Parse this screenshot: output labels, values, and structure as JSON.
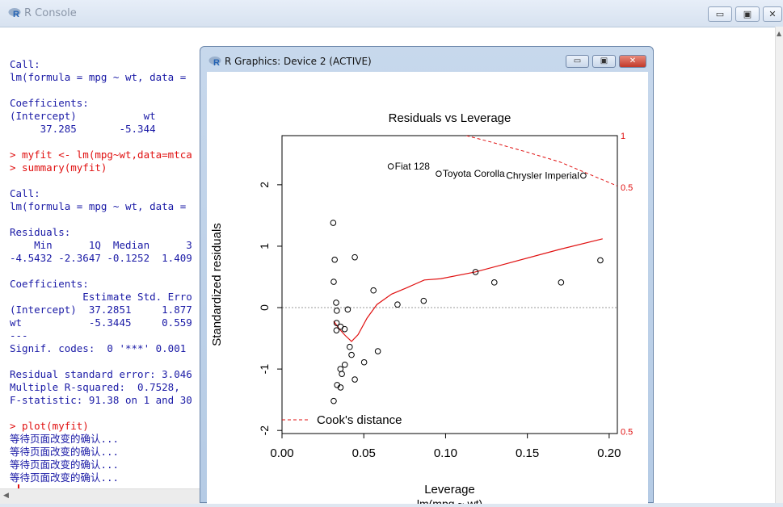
{
  "console": {
    "title": "R Console",
    "lines": [
      {
        "t": "",
        "c": ""
      },
      {
        "t": "Call:",
        "c": ""
      },
      {
        "t": "lm(formula = mpg ~ wt, data = ",
        "c": ""
      },
      {
        "t": "",
        "c": ""
      },
      {
        "t": "Coefficients:",
        "c": ""
      },
      {
        "t": "(Intercept)           wt",
        "c": ""
      },
      {
        "t": "     37.285       -5.344",
        "c": ""
      },
      {
        "t": "",
        "c": ""
      },
      {
        "t": "> myfit <- lm(mpg~wt,data=mtca",
        "c": "red"
      },
      {
        "t": "> summary(myfit)",
        "c": "red"
      },
      {
        "t": "",
        "c": ""
      },
      {
        "t": "Call:",
        "c": ""
      },
      {
        "t": "lm(formula = mpg ~ wt, data = ",
        "c": ""
      },
      {
        "t": "",
        "c": ""
      },
      {
        "t": "Residuals:",
        "c": ""
      },
      {
        "t": "    Min      1Q  Median      3",
        "c": ""
      },
      {
        "t": "-4.5432 -2.3647 -0.1252  1.409",
        "c": ""
      },
      {
        "t": "",
        "c": ""
      },
      {
        "t": "Coefficients:",
        "c": ""
      },
      {
        "t": "            Estimate Std. Erro",
        "c": ""
      },
      {
        "t": "(Intercept)  37.2851     1.877",
        "c": ""
      },
      {
        "t": "wt           -5.3445     0.559",
        "c": ""
      },
      {
        "t": "---",
        "c": ""
      },
      {
        "t": "Signif. codes:  0 '***' 0.001",
        "c": ""
      },
      {
        "t": "",
        "c": ""
      },
      {
        "t": "Residual standard error: 3.046",
        "c": ""
      },
      {
        "t": "Multiple R-squared:  0.7528,",
        "c": ""
      },
      {
        "t": "F-statistic: 91.38 on 1 and 30",
        "c": ""
      },
      {
        "t": "",
        "c": ""
      },
      {
        "t": "> plot(myfit)",
        "c": "red"
      },
      {
        "t": "等待页面改变的确认...",
        "c": ""
      },
      {
        "t": "等待页面改变的确认...",
        "c": ""
      },
      {
        "t": "等待页面改变的确认...",
        "c": ""
      },
      {
        "t": "等待页面改变的确认...",
        "c": ""
      }
    ],
    "prompt": ">",
    "window_buttons": {
      "minimize": "▭",
      "maximize": "▣",
      "close": "✕"
    }
  },
  "graphics": {
    "title": "R Graphics: Device 2 (ACTIVE)",
    "window_buttons": {
      "minimize": "▭",
      "maximize": "▣",
      "close": "✕"
    }
  },
  "chart_data": {
    "type": "scatter",
    "title": "Residuals vs Leverage",
    "xlabel": "Leverage",
    "subtitle": "lm(mpg ~ wt)",
    "ylabel": "Standardized residuals",
    "xlim": [
      0.0,
      0.205
    ],
    "ylim": [
      -2.05,
      2.8
    ],
    "xticks": [
      0.0,
      0.05,
      0.1,
      0.15,
      0.2
    ],
    "xtick_labels": [
      "0.00",
      "0.05",
      "0.10",
      "0.15",
      "0.20"
    ],
    "yticks": [
      -2,
      -1,
      0,
      1,
      2
    ],
    "ytick_labels": [
      "-2",
      "-1",
      "0",
      "1",
      "2"
    ],
    "right_labels": [
      {
        "y": 2.8,
        "text": "1"
      },
      {
        "y": 1.96,
        "text": "0.5"
      },
      {
        "y": -2.02,
        "text": "0.5"
      }
    ],
    "points": [
      [
        0.0313,
        1.38
      ],
      [
        0.0322,
        0.78
      ],
      [
        0.0316,
        0.42
      ],
      [
        0.0331,
        0.08
      ],
      [
        0.0335,
        -0.05
      ],
      [
        0.0334,
        -0.25
      ],
      [
        0.0333,
        -0.37
      ],
      [
        0.0358,
        -0.31
      ],
      [
        0.0383,
        -0.35
      ],
      [
        0.0402,
        -0.03
      ],
      [
        0.0414,
        -0.64
      ],
      [
        0.0425,
        -0.77
      ],
      [
        0.0384,
        -0.93
      ],
      [
        0.0357,
        -1.0
      ],
      [
        0.0366,
        -1.08
      ],
      [
        0.0337,
        -1.26
      ],
      [
        0.0358,
        -1.3
      ],
      [
        0.0445,
        -1.17
      ],
      [
        0.0316,
        -1.52
      ],
      [
        0.0445,
        0.82
      ],
      [
        0.0502,
        -0.89
      ],
      [
        0.0559,
        0.28
      ],
      [
        0.0586,
        -0.71
      ],
      [
        0.0706,
        0.05
      ],
      [
        0.0866,
        0.11
      ],
      [
        0.1183,
        0.58
      ],
      [
        0.1298,
        0.41
      ],
      [
        0.1706,
        0.41
      ],
      [
        0.1946,
        0.77
      ],
      [
        0.0665,
        2.3
      ],
      [
        0.0958,
        2.18
      ],
      [
        0.1842,
        2.15
      ]
    ],
    "point_labels": [
      {
        "x": 0.0665,
        "y": 2.3,
        "text": "Fiat 128"
      },
      {
        "x": 0.0958,
        "y": 2.18,
        "text": "Toyota Corolla"
      },
      {
        "x": 0.1842,
        "y": 2.15,
        "text": "Chrysler Imperial"
      }
    ],
    "smooth_line": [
      [
        0.0316,
        -0.22
      ],
      [
        0.0345,
        -0.33
      ],
      [
        0.0385,
        -0.45
      ],
      [
        0.0425,
        -0.55
      ],
      [
        0.0465,
        -0.44
      ],
      [
        0.052,
        -0.17
      ],
      [
        0.058,
        0.05
      ],
      [
        0.067,
        0.22
      ],
      [
        0.076,
        0.32
      ],
      [
        0.087,
        0.45
      ],
      [
        0.097,
        0.47
      ],
      [
        0.118,
        0.58
      ],
      [
        0.135,
        0.7
      ],
      [
        0.17,
        0.95
      ],
      [
        0.196,
        1.12
      ]
    ],
    "cooks_distance": {
      "name": "Cook's distance",
      "levels": [
        0.5,
        1
      ],
      "lines": [
        {
          "level": 1,
          "points": [
            [
              0.1127,
              2.8
            ],
            [
              0.13,
              2.68
            ],
            [
              0.15,
              2.53
            ],
            [
              0.17,
              2.37
            ],
            [
              0.205,
              1.98
            ]
          ]
        },
        {
          "level": 0.5,
          "points": [
            [
              0.205,
              1.98
            ]
          ]
        }
      ]
    },
    "legend": {
      "text": "Cook's distance",
      "placement": "bottom-left"
    },
    "colors": {
      "points": "#000000",
      "smooth": "#e01010",
      "cook": "#e01010",
      "zero_line": "#999999"
    }
  }
}
